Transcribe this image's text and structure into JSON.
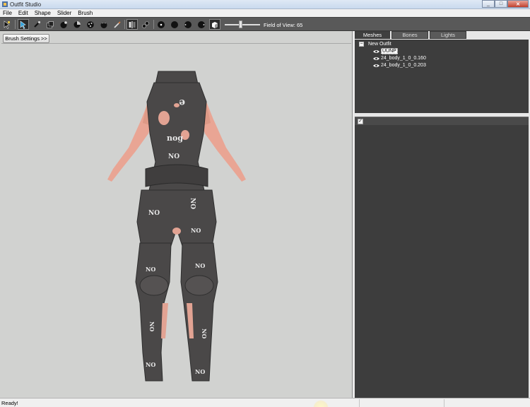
{
  "window": {
    "title": "Outfit Studio",
    "controls": [
      "minimize-icon",
      "maximize-icon",
      "close-icon"
    ]
  },
  "menu": {
    "items": [
      "File",
      "Edit",
      "Shape",
      "Slider",
      "Brush"
    ]
  },
  "toolbar": {
    "tools": [
      {
        "name": "select-tool-icon",
        "active": false
      },
      {
        "name": "transform-tool-icon",
        "active": true
      },
      {
        "name": "mask-brush-icon",
        "active": false
      },
      {
        "name": "inflate-brush-icon",
        "active": false
      },
      {
        "name": "deflate-brush-icon",
        "active": false
      },
      {
        "name": "move-brush-icon",
        "active": false
      },
      {
        "name": "smooth-brush-icon",
        "active": false
      },
      {
        "name": "weight-brush-icon",
        "active": false
      },
      {
        "name": "color-brush-icon",
        "active": false
      },
      {
        "name": "xmirror-icon",
        "active": true
      },
      {
        "name": "connected-icon",
        "active": false
      },
      {
        "name": "vertex-view-icon",
        "active": false
      },
      {
        "name": "shaded-view-icon",
        "active": false
      },
      {
        "name": "wireframe-view-icon",
        "active": false
      },
      {
        "name": "lighting-view-icon",
        "active": false
      },
      {
        "name": "texture-view-icon",
        "active": true
      }
    ],
    "field_of_view_label": "Field of View: 65",
    "field_of_view_value": 65
  },
  "viewport": {
    "brush_settings_label": "Brush Settings >>"
  },
  "right_panel": {
    "tabs": [
      {
        "label": "Meshes",
        "active": true
      },
      {
        "label": "Bones",
        "active": false
      },
      {
        "label": "Lights",
        "active": false
      }
    ],
    "tree": {
      "root_expander": "−",
      "root_label": "New Outfit",
      "meshes": [
        {
          "label": "UUNP",
          "selected": true,
          "visible": true
        },
        {
          "label": "24_body_1_0_0.160",
          "selected": false,
          "visible": true
        },
        {
          "label": "24_body_1_0_0.203",
          "selected": false,
          "visible": true
        }
      ]
    },
    "slider_check": "✓"
  },
  "statusbar": {
    "text": "Ready!"
  },
  "colors": {
    "toolbar_bg": "#595959",
    "viewport_bg": "#d1d2d0",
    "panel_bg": "#3d3d3d",
    "outfit": "#4a4848",
    "skin": "#e9a594"
  }
}
